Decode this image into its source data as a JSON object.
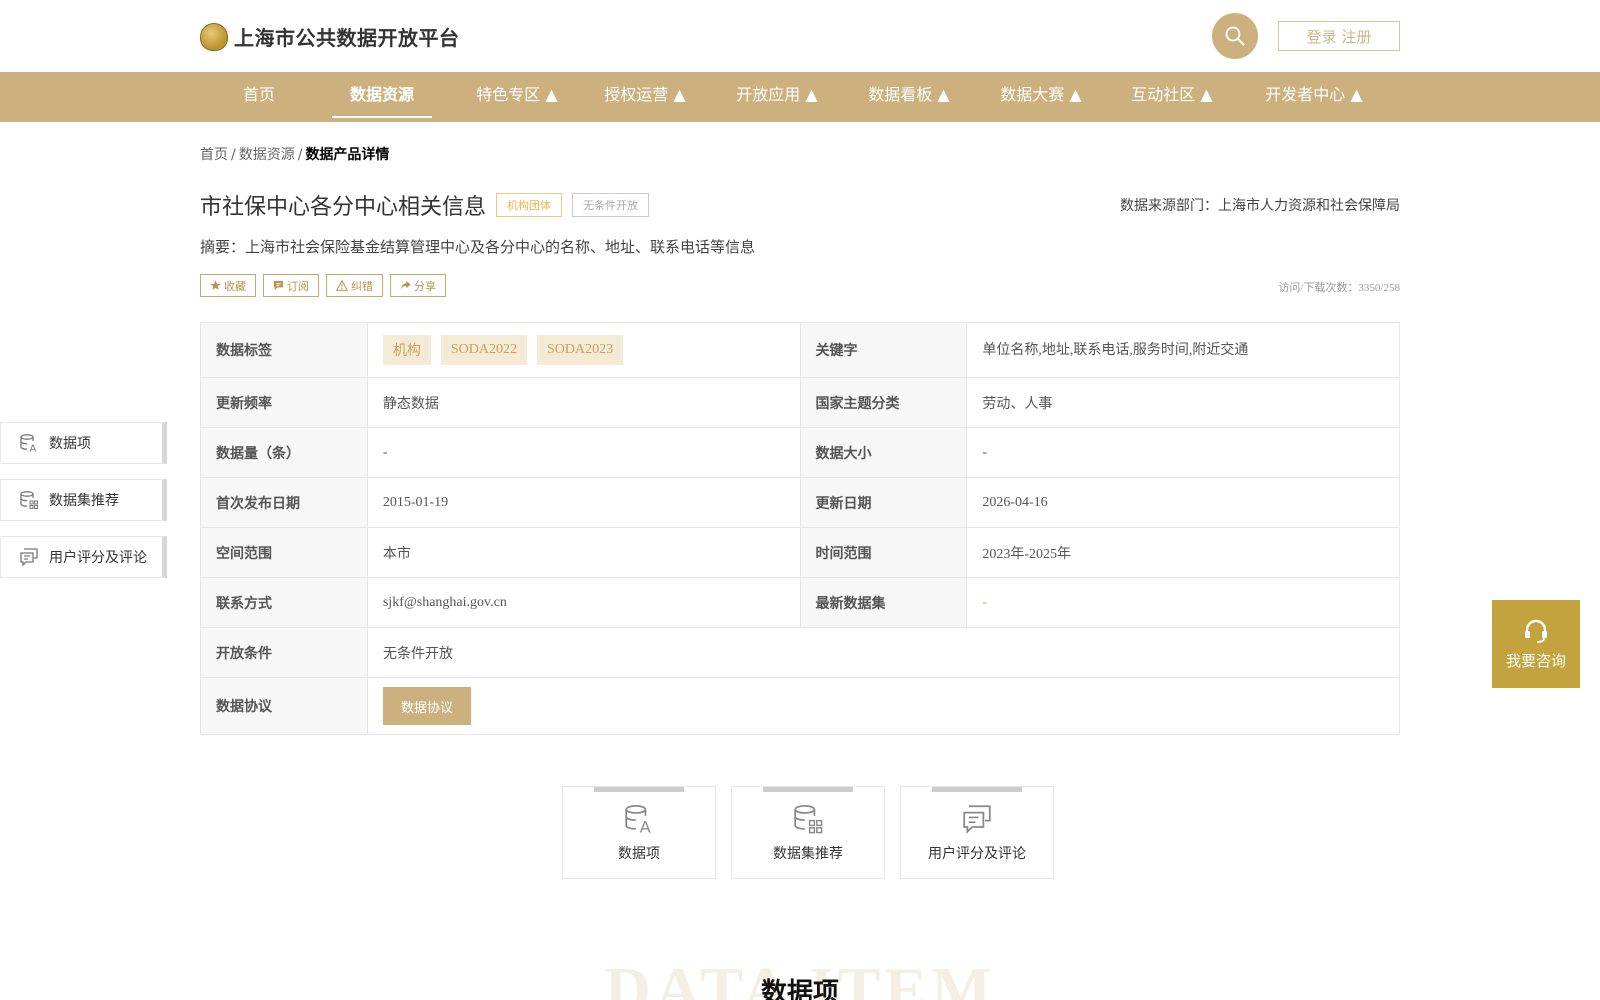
{
  "header": {
    "logo_text": "上海市公共数据开放平台",
    "login_label": "登录 注册"
  },
  "nav": {
    "items": [
      {
        "label": "首页"
      },
      {
        "label": "数据资源"
      },
      {
        "label": "特色专区 ▲"
      },
      {
        "label": "授权运营 ▲"
      },
      {
        "label": "开放应用 ▲"
      },
      {
        "label": "数据看板 ▲"
      },
      {
        "label": "数据大赛 ▲"
      },
      {
        "label": "互动社区 ▲"
      },
      {
        "label": "开发者中心 ▲"
      }
    ],
    "active_index": 1
  },
  "breadcrumb": {
    "items": [
      "首页",
      "数据资源",
      "数据产品详情"
    ],
    "separator": "/"
  },
  "product": {
    "title": "市社保中心各分中心相关信息",
    "tag_org": "机构团体",
    "tag_open": "无条件开放",
    "source_dept": "数据来源部门：上海市人力资源和社会保障局",
    "summary": "摘要：上海市社会保险基金结算管理中心及各分中心的名称、地址、联系电话等信息",
    "visits": "访问/下载次数：3350/258"
  },
  "actions": {
    "favorite": "收藏",
    "subscribe": "订阅",
    "report": "纠错",
    "share": "分享"
  },
  "table": {
    "data_tags_label": "数据标签",
    "data_tags": [
      "机构",
      "SODA2022",
      "SODA2023"
    ],
    "keywords_label": "关键字",
    "keywords": "单位名称,地址,联系电话,服务时间,附近交通",
    "update_freq_label": "更新频率",
    "update_freq": "静态数据",
    "national_theme_label": "国家主题分类",
    "national_theme": "劳动、人事",
    "data_count_label": "数据量（条）",
    "data_count": "-",
    "data_size_label": "数据大小",
    "data_size": "-",
    "first_publish_label": "首次发布日期",
    "first_publish": "2015-01-19",
    "update_date_label": "更新日期",
    "update_date": "2026-04-16",
    "space_range_label": "空间范围",
    "space_range": "本市",
    "time_range_label": "时间范围",
    "time_range": "2023年-2025年",
    "contact_label": "联系方式",
    "contact": "sjkf@shanghai.gov.cn",
    "latest_dataset_label": "最新数据集",
    "latest_dataset": "-",
    "open_condition_label": "开放条件",
    "open_condition": "无条件开放",
    "agreement_label": "数据协议",
    "agreement_button": "数据协议"
  },
  "side_nav": {
    "items": [
      {
        "label": "数据项",
        "icon": "database-text-icon"
      },
      {
        "label": "数据集推荐",
        "icon": "database-grid-icon"
      },
      {
        "label": "用户评分及评论",
        "icon": "comments-icon"
      }
    ]
  },
  "cards": {
    "items": [
      {
        "label": "数据项",
        "icon": "database-text-icon"
      },
      {
        "label": "数据集推荐",
        "icon": "database-grid-icon"
      },
      {
        "label": "用户评分及评论",
        "icon": "comments-icon"
      }
    ]
  },
  "consult": {
    "label": "我要咨询"
  },
  "section": {
    "bg_text": "DATA ITEM",
    "title": "数据项"
  },
  "colors": {
    "brand": "#ccb17f",
    "consult": "#c4a23e",
    "tag_chip_bg": "#f4ead5",
    "tag_chip_text": "#c8a25a"
  }
}
